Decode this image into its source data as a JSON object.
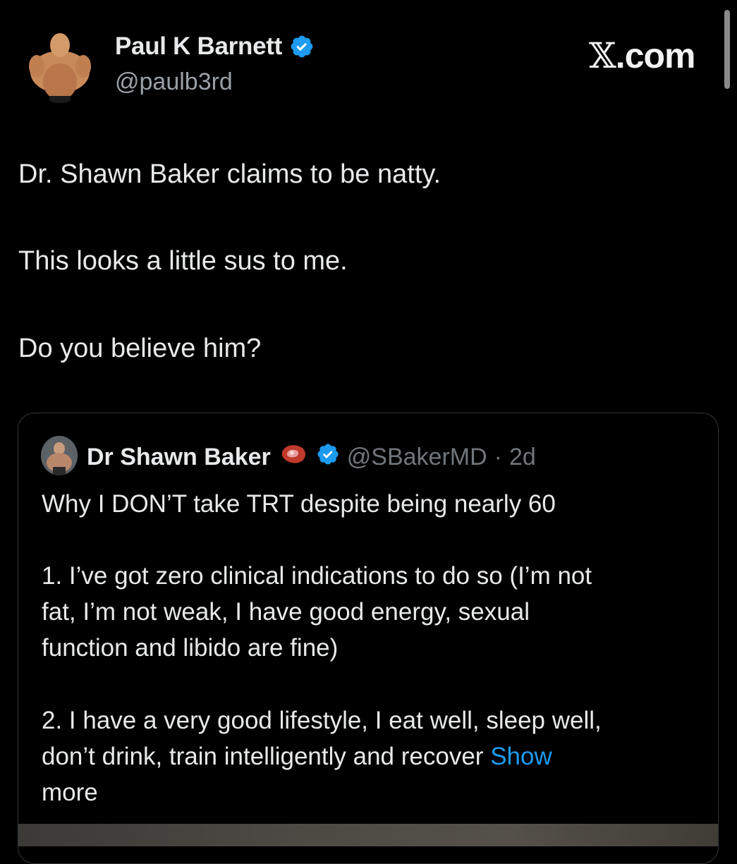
{
  "author": {
    "display_name": "Paul K Barnett",
    "handle": "@paulb3rd",
    "verified": true
  },
  "brand": {
    "glyph": "𝕏",
    "suffix": ".com"
  },
  "tweet": {
    "paragraphs": [
      "Dr. Shawn Baker claims to be natty.",
      "This looks a little sus to me.",
      "Do you believe him?"
    ]
  },
  "quote": {
    "display_name": "Dr Shawn Baker",
    "name_emoji_icon": "steak-icon",
    "handle": "@SBakerMD",
    "separator": "·",
    "time": "2d",
    "lines": [
      "Why I DON’T take TRT despite being nearly 60",
      "1. I’ve got zero clinical indications to do so (I’m not",
      "fat, I’m not weak, I have good energy, sexual",
      "function and libido are fine)",
      "2. I have a very good lifestyle, I eat well, sleep well,",
      "don’t drink, train intelligently and recover",
      "more"
    ],
    "show_more_label": "Show"
  },
  "colors": {
    "background": "#000000",
    "text": "#e7e9ea",
    "muted": "#71767b",
    "accent": "#1d9bf0"
  }
}
